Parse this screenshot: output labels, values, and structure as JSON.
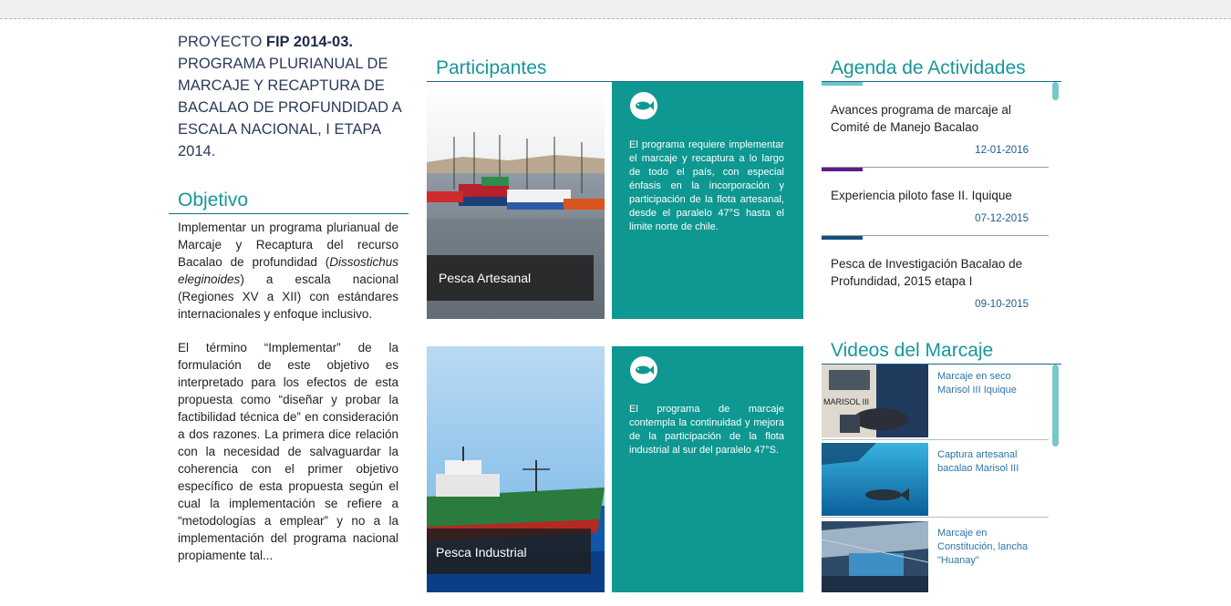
{
  "project": {
    "prefix": "PROYECTO ",
    "code": "FIP 2014-03.",
    "title": "PROGRAMA PLURIANUAL DE MARCAJE Y RECAPTURA DE BACALAO DE PROFUNDIDAD A ESCALA NACIONAL, I ETAPA 2014."
  },
  "objective": {
    "heading": "Objetivo",
    "p1_start": "Implementar un programa plurianual de Marcaje y Recaptura del recurso Bacalao de profundidad (",
    "p1_species": "Dissostichus eleginoides",
    "p1_end": ") a escala nacional (Regiones XV a XII) con estándares internacionales y enfoque inclusivo.",
    "p2": "El término “Implementar” de la formulación de este objetivo es interpretado para los efectos de esta propuesta como “diseñar y probar la factibilidad técnica de” en consideración a dos razones. La primera dice relación con la necesidad de salvaguardar la coherencia con el primer objetivo específico de esta propuesta según el cual la implementación se refiere a “metodologías a emplear” y no a la implementación del programa nacional propiamente tal..."
  },
  "participants": {
    "heading": "Participantes",
    "tiles": [
      {
        "caption": "Pesca Artesanal",
        "text": "El programa requiere implementar el marcaje y recaptura a lo largo de todo el país, con especial énfasis en la incorporación y participación de la flota artesanal, desde el paralelo 47°S hasta el limite norte de chile."
      },
      {
        "caption": "Pesca Industrial",
        "text": "El programa de marcaje contempla la continuidad y mejora de la participación de la flota industrial al sur del paralelo 47°S."
      }
    ]
  },
  "agenda": {
    "heading": "Agenda de Actividades",
    "items": [
      {
        "title": "Avances programa de marcaje al Comité de Manejo Bacalao",
        "date": "12-01-2016",
        "accent": "#6fc3c9"
      },
      {
        "title": "Experiencia piloto fase II. Iquique",
        "date": "07-12-2015",
        "accent": "#5b1c8c"
      },
      {
        "title": "Pesca de Investigación Bacalao de Profundidad, 2015 etapa I",
        "date": "09-10-2015",
        "accent": "#14507e"
      }
    ]
  },
  "videos": {
    "heading": "Videos del Marcaje",
    "items": [
      {
        "label": "Marcaje en seco Marisol III Iquique",
        "thumb_text": "MARISOL III"
      },
      {
        "label": "Captura artesanal bacalao Marisol III"
      },
      {
        "label": "Marcaje en Constitución, lancha \"Huanay\""
      }
    ]
  },
  "colors": {
    "teal": "#0e9891",
    "heading": "#17979a",
    "rule": "#176a88",
    "date": "#1a5e8a",
    "video_link": "#2d74a8"
  }
}
